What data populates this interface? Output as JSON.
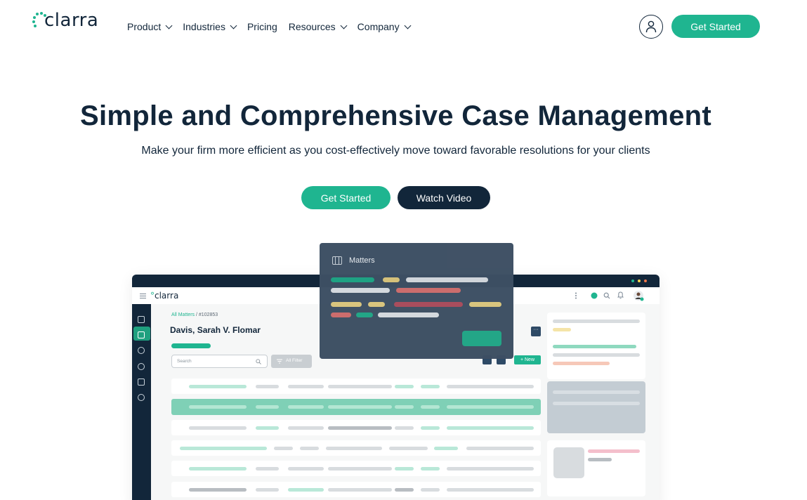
{
  "brand": {
    "logo_text": "clarra",
    "accent_color": "#1fb590",
    "navy_color": "#12263a"
  },
  "nav": {
    "items": [
      {
        "label": "Product",
        "has_dropdown": true
      },
      {
        "label": "Industries",
        "has_dropdown": true
      },
      {
        "label": "Pricing",
        "has_dropdown": false
      },
      {
        "label": "Resources",
        "has_dropdown": true
      },
      {
        "label": "Company",
        "has_dropdown": true
      }
    ],
    "user_icon": "user-icon",
    "cta_label": "Get Started"
  },
  "hero": {
    "title": "Simple and Comprehensive Case Management",
    "subtitle": "Make your firm more efficient as you cost-effectively move toward favorable resolutions for your clients",
    "primary_cta": "Get Started",
    "secondary_cta": "Watch Video"
  },
  "mockup": {
    "logo_text": "clarra",
    "breadcrumb_root": "All Matters",
    "breadcrumb_sep": " / ",
    "breadcrumb_id": "#102853",
    "case_title": "Davis, Sarah V. Flomar",
    "search_placeholder": "Search",
    "filter_label": "All Filter",
    "new_label": "+ New",
    "more_label": "···",
    "popup_title": "Matters"
  }
}
